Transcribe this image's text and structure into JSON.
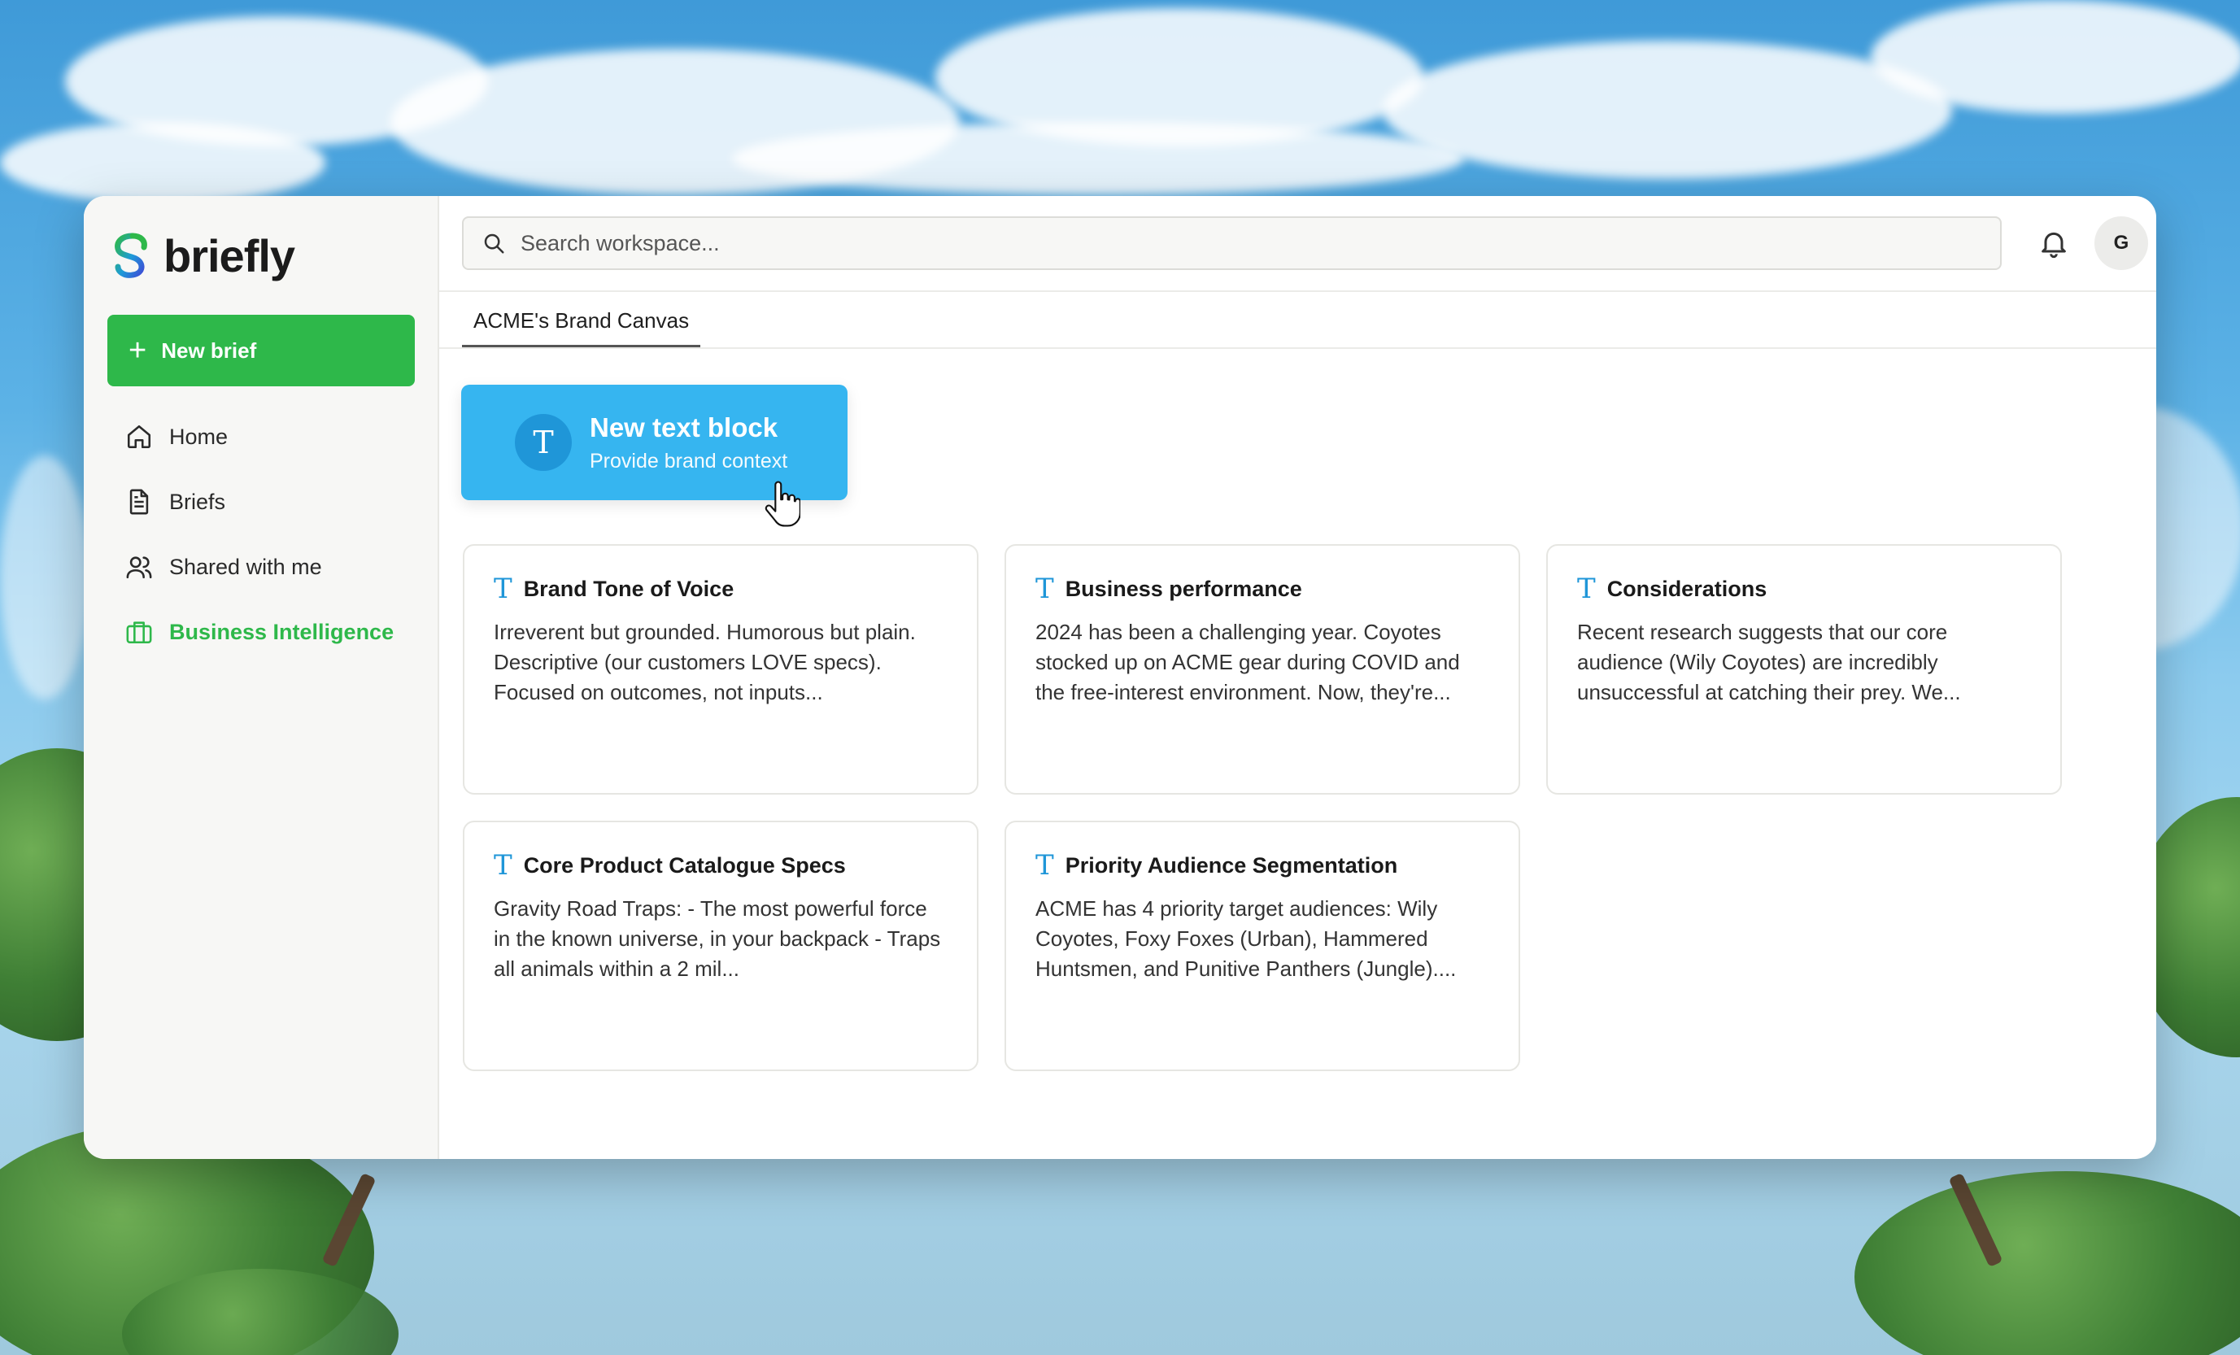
{
  "app": {
    "name": "briefly",
    "accent_color": "#2eb84a",
    "block_color": "#36b5f0"
  },
  "sidebar": {
    "new_brief_label": "New brief",
    "items": [
      {
        "label": "Home",
        "icon": "home-icon",
        "active": false
      },
      {
        "label": "Briefs",
        "icon": "document-icon",
        "active": false
      },
      {
        "label": "Shared with me",
        "icon": "users-icon",
        "active": false
      },
      {
        "label": "Business Intelligence",
        "icon": "briefcase-icon",
        "active": true
      }
    ]
  },
  "header": {
    "search_placeholder": "Search workspace...",
    "avatar_initial": "G"
  },
  "tabs": [
    {
      "label": "ACME's Brand Canvas",
      "active": true
    }
  ],
  "new_block": {
    "title": "New text block",
    "subtitle": "Provide brand context",
    "icon_glyph": "T"
  },
  "cards": [
    {
      "title": "Brand Tone of Voice",
      "body": "Irreverent but grounded. Humorous but plain. Descriptive (our customers LOVE specs). Focused on outcomes, not inputs...",
      "icon_glyph": "T"
    },
    {
      "title": "Business performance",
      "body": "2024 has been a challenging year. Coyotes stocked up on ACME gear during COVID and the free-interest environment. Now, they're...",
      "icon_glyph": "T"
    },
    {
      "title": "Considerations",
      "body": "Recent research suggests that our core audience (Wily Coyotes) are incredibly unsuccessful at catching their prey. We...",
      "icon_glyph": "T"
    },
    {
      "title": "Core Product Catalogue Specs",
      "body": "Gravity Road Traps: - The most powerful force in the known universe, in your backpack - Traps all animals within a 2 mil...",
      "icon_glyph": "T"
    },
    {
      "title": "Priority Audience Segmentation",
      "body": "ACME has 4 priority target audiences: Wily Coyotes, Foxy Foxes (Urban), Hammered Huntsmen, and Punitive Panthers (Jungle)....",
      "icon_glyph": "T"
    }
  ]
}
